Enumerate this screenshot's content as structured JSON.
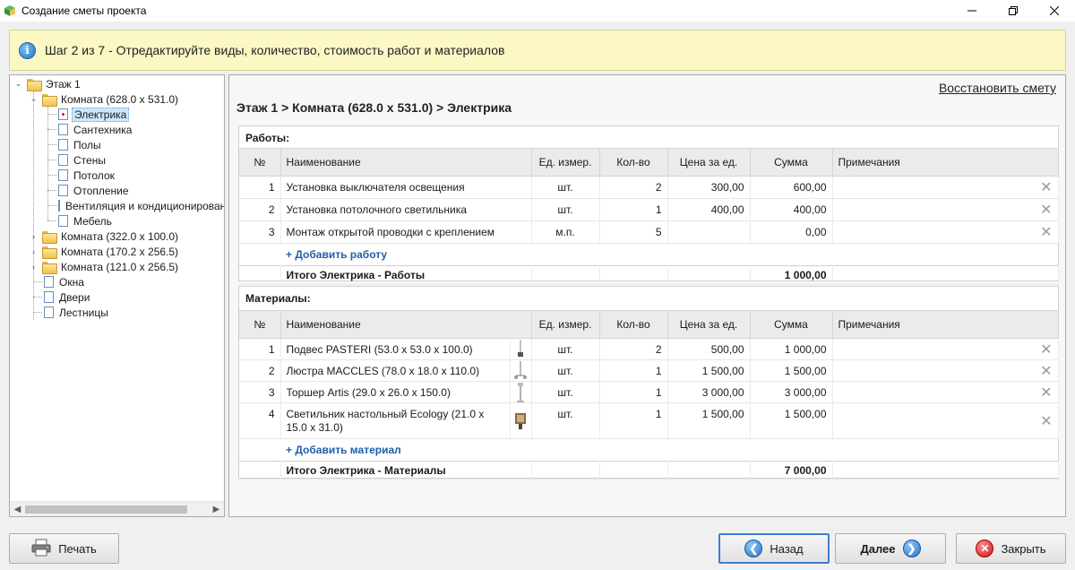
{
  "window": {
    "title": "Создание сметы проекта"
  },
  "info": {
    "text": "Шаг 2 из 7 - Отредактируйте виды, количество, стоимость работ и материалов"
  },
  "tree": {
    "floor": "Этаж 1",
    "room1": "Комната (628.0 x 531.0)",
    "room1_items": [
      "Электрика",
      "Сантехника",
      "Полы",
      "Стены",
      "Потолок",
      "Отопление",
      "Вентиляция и кондиционирование",
      "Мебель"
    ],
    "room2": "Комната (322.0 x 100.0)",
    "room3": "Комната (170.2 x 256.5)",
    "room4": "Комната (121.0 x 256.5)",
    "others": [
      "Окна",
      "Двери",
      "Лестницы"
    ]
  },
  "main": {
    "restore_label": "Восстановить смету",
    "breadcrumb": "Этаж 1 > Комната (628.0 x 531.0) > Электрика"
  },
  "columns": {
    "num": "№",
    "name": "Наименование",
    "unit": "Ед. измер.",
    "qty": "Кол-во",
    "price": "Цена за ед.",
    "sum": "Сумма",
    "notes": "Примечания"
  },
  "works": {
    "title": "Работы:",
    "rows": [
      {
        "num": "1",
        "name": "Установка выключателя освещения",
        "unit": "шт.",
        "qty": "2",
        "price": "300,00",
        "sum": "600,00",
        "note": ""
      },
      {
        "num": "2",
        "name": "Установка потолочного светильника",
        "unit": "шт.",
        "qty": "1",
        "price": "400,00",
        "sum": "400,00",
        "note": ""
      },
      {
        "num": "3",
        "name": "Монтаж открытой проводки с креплением",
        "unit": "м.п.",
        "qty": "5",
        "price": "",
        "sum": "0,00",
        "note": ""
      }
    ],
    "add_label": "+ Добавить работу",
    "total_label": "Итого Электрика - Работы",
    "total_value": "1 000,00"
  },
  "materials": {
    "title": "Материалы:",
    "rows": [
      {
        "num": "1",
        "name": "Подвес PASTERI (53.0 x 53.0 x 100.0)",
        "unit": "шт.",
        "qty": "2",
        "price": "500,00",
        "sum": "1 000,00",
        "note": ""
      },
      {
        "num": "2",
        "name": "Люстра MACCLES (78.0 x 18.0 x 110.0)",
        "unit": "шт.",
        "qty": "1",
        "price": "1 500,00",
        "sum": "1 500,00",
        "note": ""
      },
      {
        "num": "3",
        "name": "Торшер Artis (29.0 x 26.0 x 150.0)",
        "unit": "шт.",
        "qty": "1",
        "price": "3 000,00",
        "sum": "3 000,00",
        "note": ""
      },
      {
        "num": "4",
        "name": "Светильник настольный Ecology (21.0 x 15.0 x 31.0)",
        "unit": "шт.",
        "qty": "1",
        "price": "1 500,00",
        "sum": "1 500,00",
        "note": ""
      }
    ],
    "add_label": "+ Добавить материал",
    "total_label": "Итого Электрика - Материалы",
    "total_value": "7 000,00"
  },
  "buttons": {
    "print": "Печать",
    "back": "Назад",
    "next": "Далее",
    "close": "Закрыть"
  },
  "colors": {
    "info_bg": "#fbf8c4",
    "link": "#1f5fa8",
    "focus": "#3c7fd4"
  }
}
